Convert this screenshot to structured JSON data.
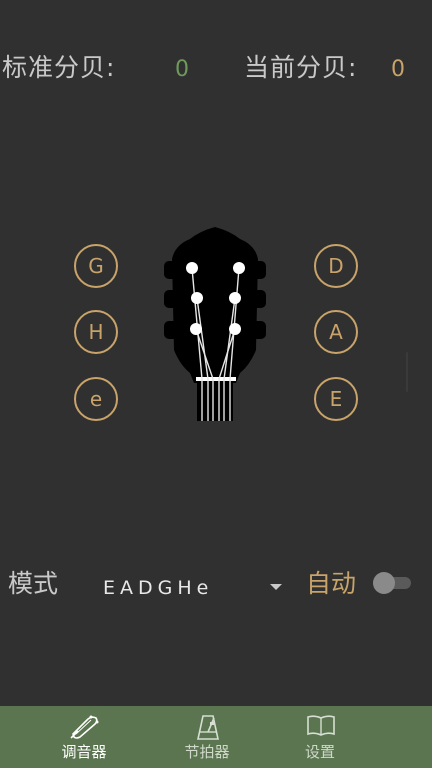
{
  "decibel": {
    "standard_label": "标准分贝:",
    "standard_value": "0",
    "current_label": "当前分贝:",
    "current_value": "0"
  },
  "strings": {
    "left": [
      "G",
      "H",
      "e"
    ],
    "right": [
      "D",
      "A",
      "E"
    ]
  },
  "mode": {
    "label": "模式",
    "tuning": "EADGHe",
    "auto_label": "自动",
    "auto_enabled": false
  },
  "tabs": [
    {
      "label": "调音器",
      "icon": "guitar-headstock-icon",
      "active": true
    },
    {
      "label": "节拍器",
      "icon": "metronome-icon",
      "active": false
    },
    {
      "label": "设置",
      "icon": "book-icon",
      "active": false
    }
  ],
  "colors": {
    "background": "#303030",
    "accent_gold": "#c8a36a",
    "accent_green": "#6f9a5c",
    "tabbar": "#5a7550"
  }
}
